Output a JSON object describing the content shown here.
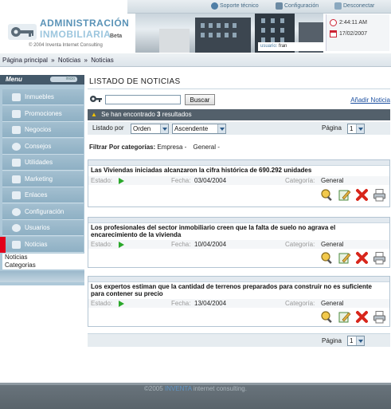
{
  "header": {
    "logo_line1": "ADMINISTRACIÓN",
    "logo_line2": "INMOBILIARIA",
    "logo_beta": "Beta",
    "logo_copyright": "© 2004 Inventa Internet Consulting",
    "links": {
      "support": "Soporte técnico",
      "config": "Configuración",
      "logout": "Desconectar"
    },
    "time": "2:44:11 AM",
    "date": "17/02/2007",
    "user_label": "usuario:",
    "user_name": "fran"
  },
  "breadcrumb": {
    "items": [
      "Página principal",
      "Noticias",
      "Noticias"
    ],
    "separator": "»"
  },
  "sidebar": {
    "menu_title": "Menu",
    "menu_tab": "inicio",
    "items": [
      {
        "label": "Inmuebles",
        "icon": "building-icon"
      },
      {
        "label": "Promociones",
        "icon": "promotion-icon"
      },
      {
        "label": "Negocios",
        "icon": "business-icon"
      },
      {
        "label": "Consejos",
        "icon": "tips-icon"
      },
      {
        "label": "Utilidades",
        "icon": "tools-icon"
      },
      {
        "label": "Marketing",
        "icon": "marketing-icon"
      },
      {
        "label": "Enlaces",
        "icon": "links-icon"
      },
      {
        "label": "Configuración",
        "icon": "settings-icon"
      },
      {
        "label": "Usuarios",
        "icon": "users-icon"
      },
      {
        "label": "Noticias",
        "icon": "news-icon"
      }
    ],
    "active_index": 9,
    "submenu": [
      "Noticias",
      "Categorias"
    ]
  },
  "main": {
    "title": "LISTADO DE NOTICIAS",
    "search": {
      "value": "",
      "button": "Buscar"
    },
    "add_link": "Añadir Noticia",
    "results_prefix": "Se han encontrado",
    "results_count": "3",
    "results_suffix": "resultados",
    "sort_label": "Listado por",
    "sort_field": "Orden",
    "sort_order": "Ascendente",
    "page_label": "Página",
    "page_value": "1",
    "filter_label": "Filtrar Por categorías:",
    "filter_options": [
      "Empresa",
      "-",
      "General",
      "-"
    ],
    "field_labels": {
      "state": "Estado:",
      "date": "Fecha:",
      "category": "Categoría:"
    },
    "news": [
      {
        "title": "Las Viviendas iniciadas alcanzaron la cifra histórica de 690.292 unidades",
        "date": "03/04/2004",
        "category": "General"
      },
      {
        "title": "Los profesionales del sector inmobiliario creen que la falta de suelo no agrava el encarecimiento de la vivienda",
        "date": "10/04/2004",
        "category": "General"
      },
      {
        "title": "Los expertos estiman que la cantidad de terrenos preparados para construir no es suficiente para contener su precio",
        "date": "13/04/2004",
        "category": "General"
      }
    ]
  },
  "footer": {
    "prefix": "©2005",
    "brand": "INVENTA",
    "suffix": "internet consulting."
  }
}
